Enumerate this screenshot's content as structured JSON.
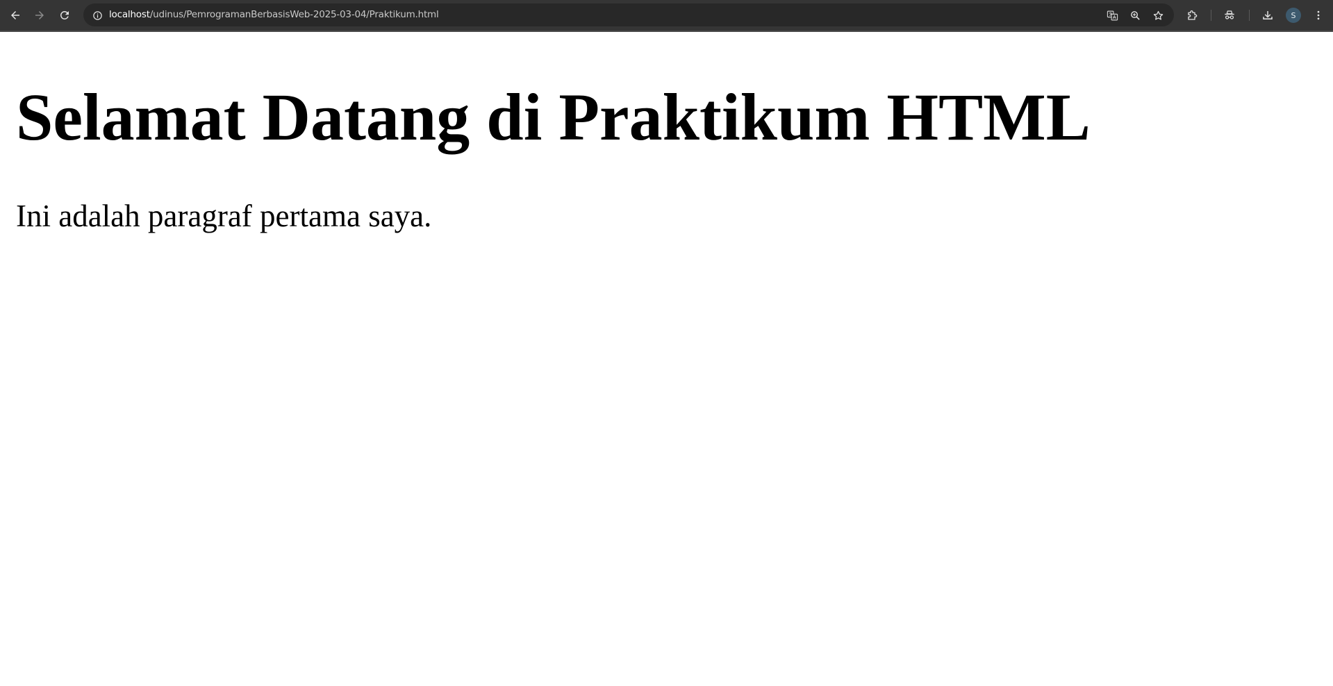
{
  "browser": {
    "url_host": "localhost",
    "url_path": "/udinus/PemrogramanBerbasisWeb-2025-03-04/Praktikum.html",
    "icons": {
      "back": "back-arrow-icon",
      "forward": "forward-arrow-icon",
      "reload": "reload-icon",
      "site_info": "info-icon",
      "translate": "translate-icon",
      "zoom": "zoom-icon",
      "bookmark": "star-icon",
      "extensions": "puzzle-icon",
      "incognito": "incognito-icon",
      "download": "download-icon",
      "menu": "kebab-menu-icon"
    },
    "profile_initial": "S"
  },
  "page": {
    "heading": "Selamat Datang di Praktikum HTML",
    "paragraph": "Ini adalah paragraf pertama saya."
  },
  "colors": {
    "toolbar": "#353535",
    "omnibox": "#282828",
    "page_bg": "#ffffff",
    "text": "#000000",
    "avatar": "#3d5a6e"
  }
}
